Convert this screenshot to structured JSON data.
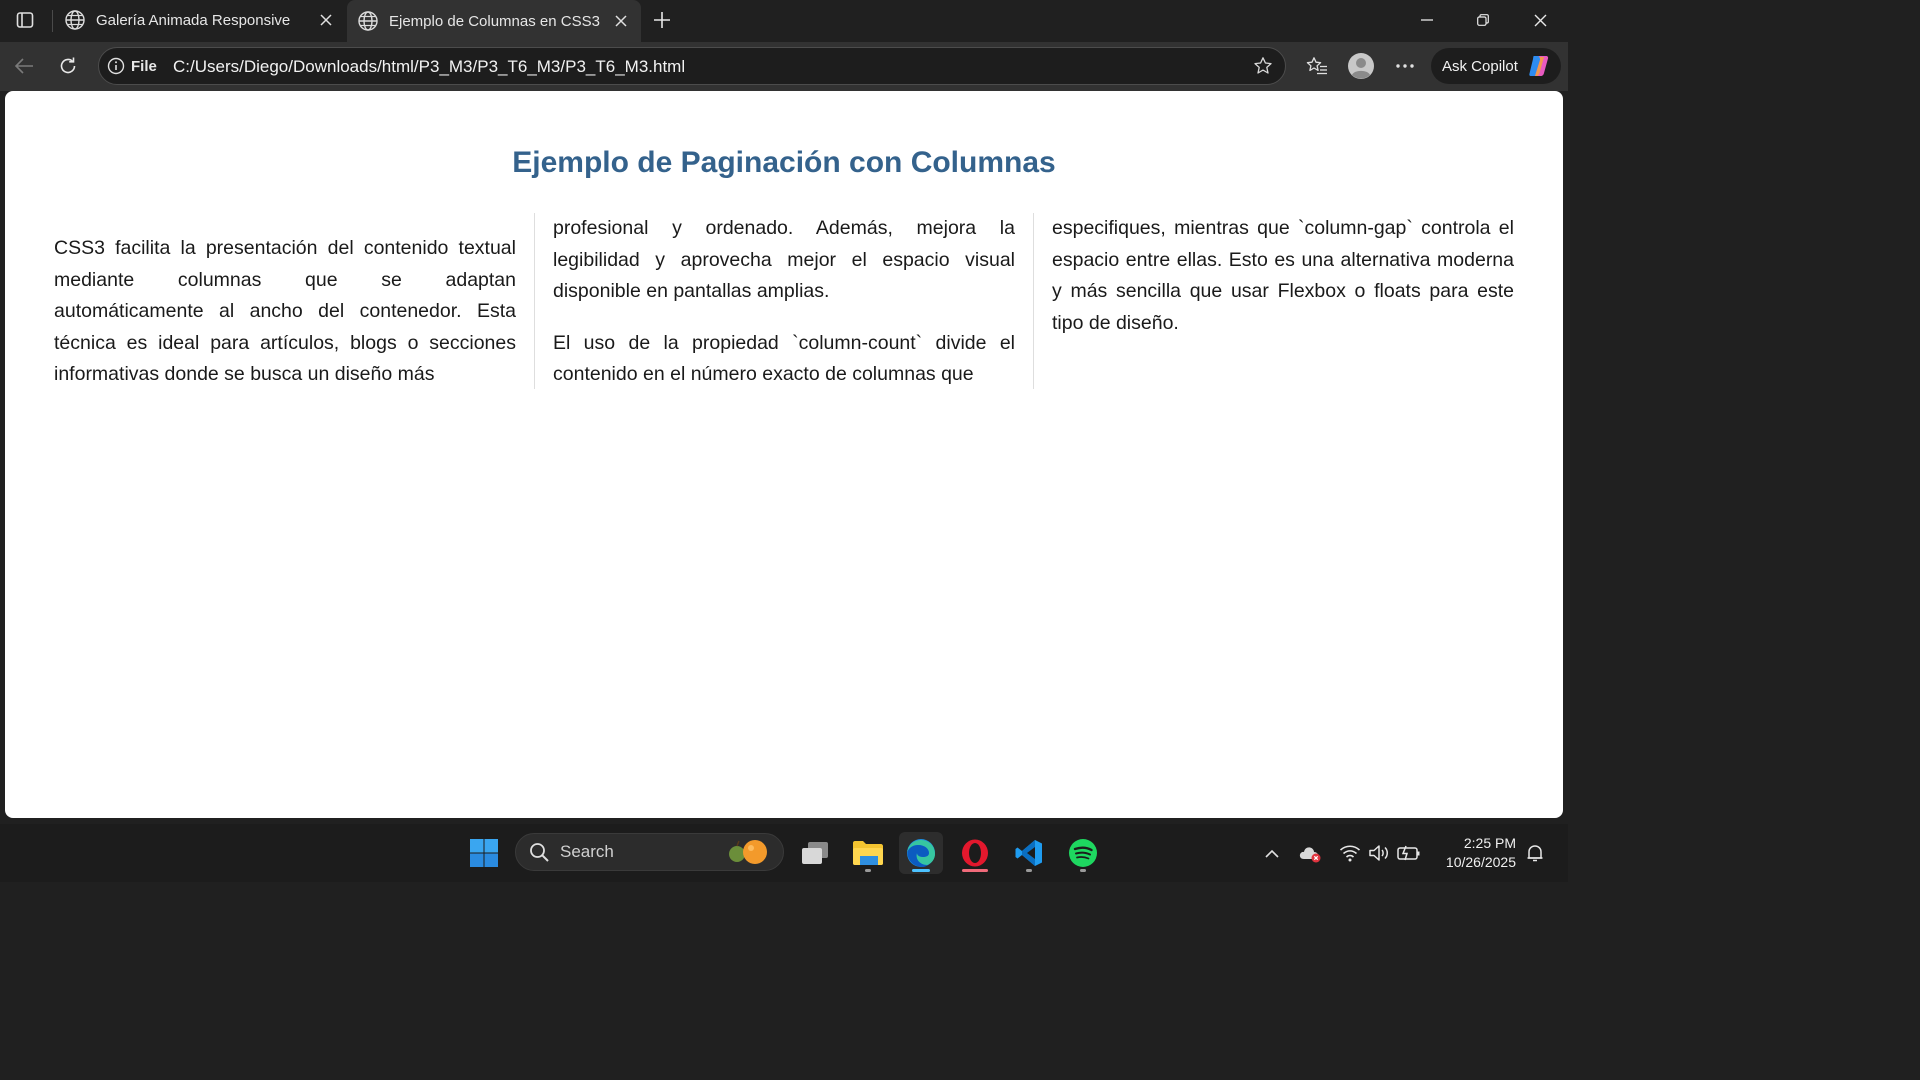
{
  "browser": {
    "tabs": [
      {
        "title": "Galería Animada Responsive",
        "active": false
      },
      {
        "title": "Ejemplo de Columnas en CSS3",
        "active": true
      }
    ],
    "site_info_label": "File",
    "url": "C:/Users/Diego/Downloads/html/P3_M3/P3_T6_M3/P3_T6_M3.html",
    "copilot_label": "Ask Copilot"
  },
  "page": {
    "heading": "Ejemplo de Paginación con Columnas",
    "column1_p1": "CSS3 facilita la presentación del contenido textual mediante columnas que se adaptan automáticamente al ancho del contenedor. Esta técnica es ideal para artículos, blogs o secciones informativas donde se busca un diseño más",
    "column2_p1": "profesional y ordenado. Además, mejora la legibilidad y aprovecha mejor el espacio visual disponible en pantallas amplias.",
    "column2_p2": "El uso de la propiedad `column-count` divide el contenido en el número exacto de columnas que",
    "column3_p1": "especifiques, mientras que `column-gap` controla el espacio entre ellas. Esto es una alternativa moderna y más sencilla que usar Flexbox o floats para este tipo de diseño.",
    "heading_color": "#34628c"
  },
  "taskbar": {
    "search_placeholder": "Search",
    "time": "2:25 PM",
    "date": "10/26/2025",
    "apps": [
      "file-explorer",
      "edge",
      "opera",
      "vscode",
      "spotify"
    ]
  }
}
